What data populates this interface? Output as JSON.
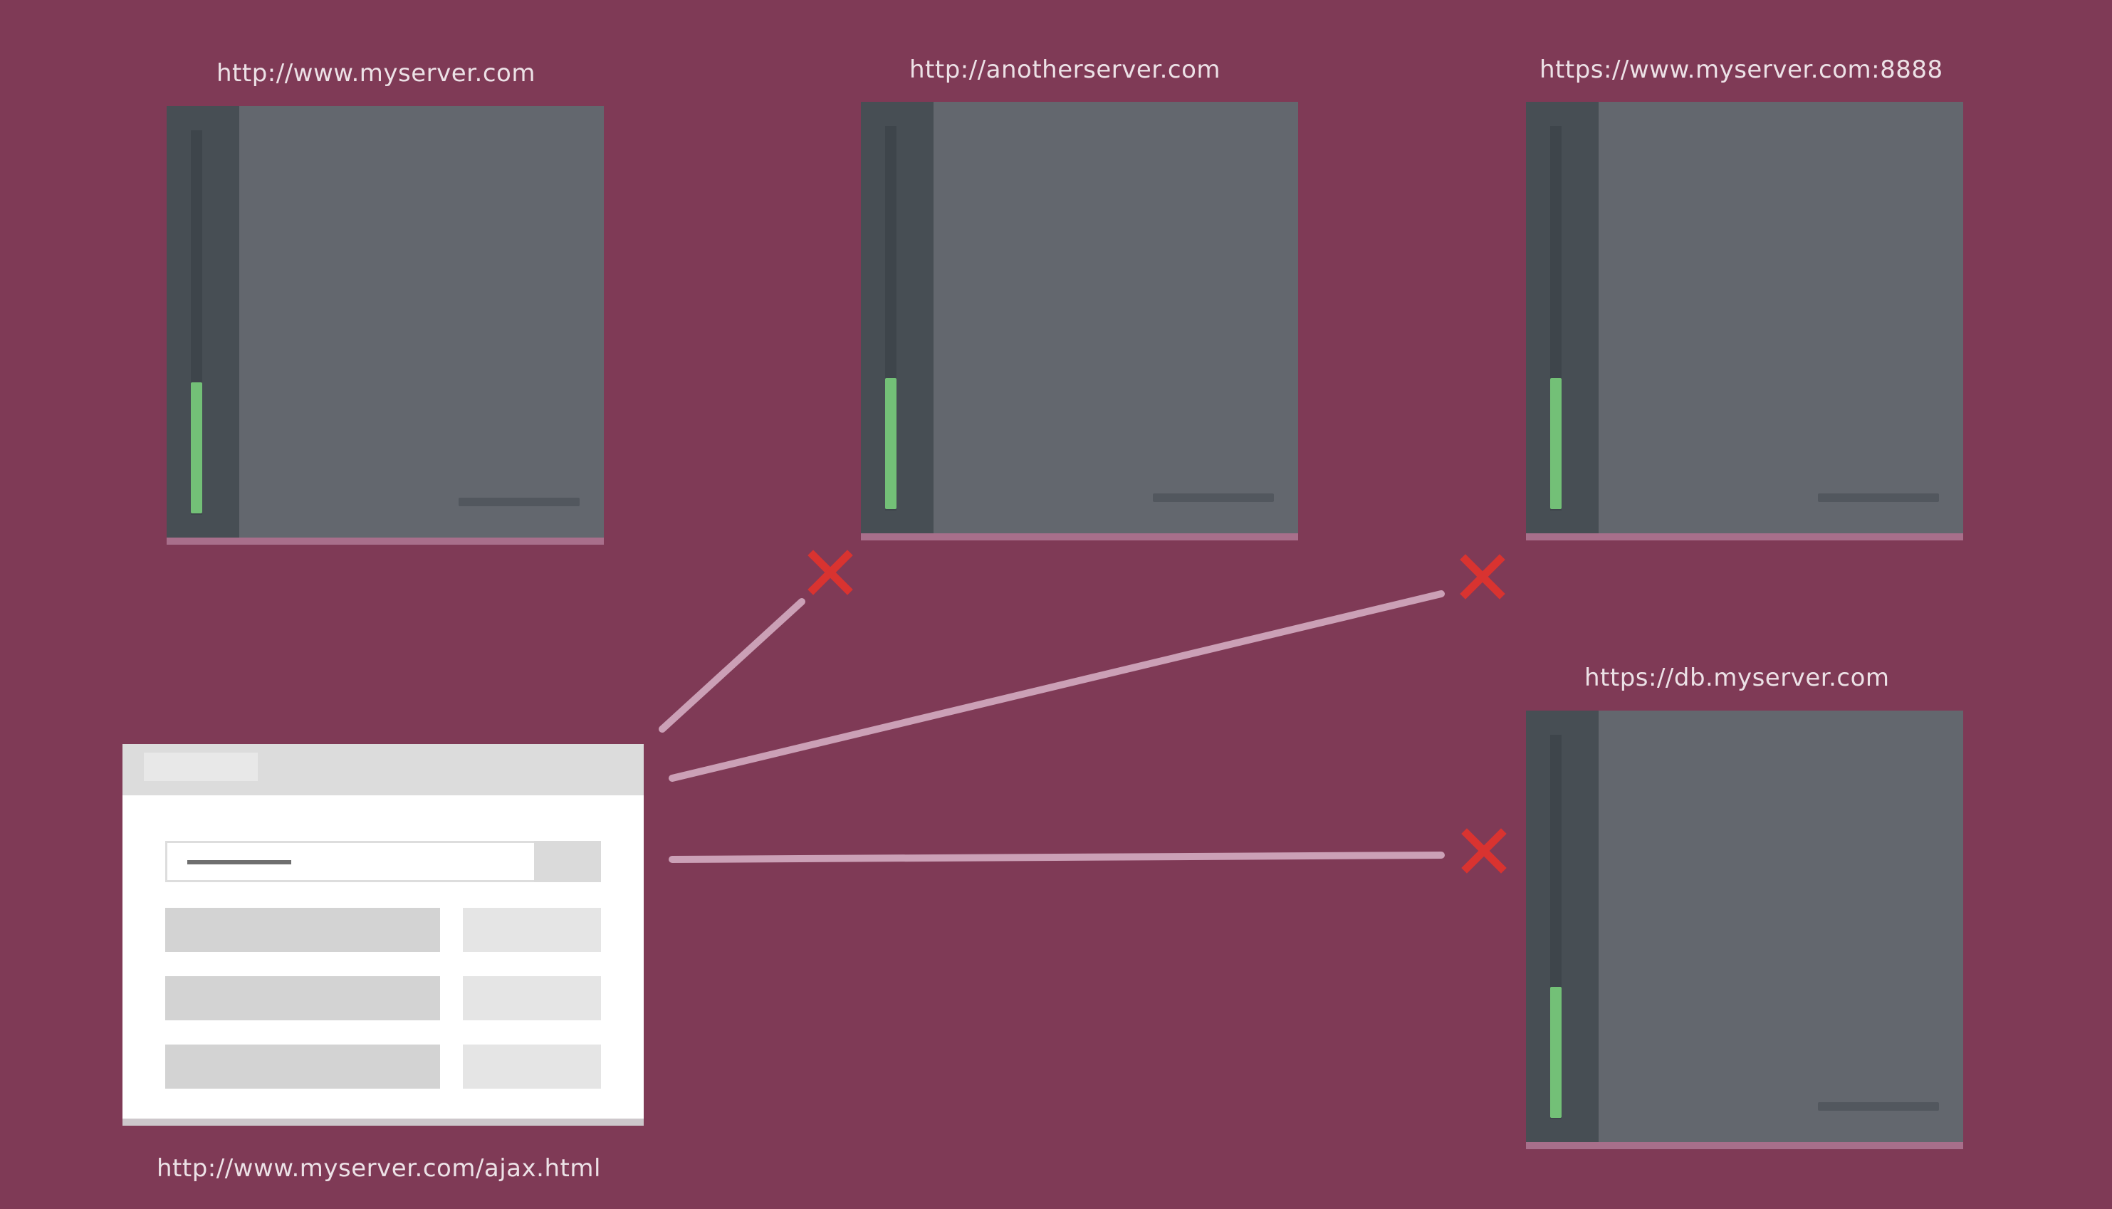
{
  "colors": {
    "background": "#7f3a56",
    "label_text": "#ece1e6",
    "connection_line": "#cba0b6",
    "blocked_marker": "#d93330",
    "server_led": "#73c077"
  },
  "servers": [
    {
      "id": "myserver",
      "url": "http://www.myserver.com",
      "icon": "server-tower-icon"
    },
    {
      "id": "anotherserver",
      "url": "http://anotherserver.com",
      "icon": "server-tower-icon"
    },
    {
      "id": "myserver-8888",
      "url": "https://www.myserver.com:8888",
      "icon": "server-tower-icon"
    },
    {
      "id": "db-myserver",
      "url": "https://db.myserver.com",
      "icon": "server-tower-icon"
    }
  ],
  "browser": {
    "url": "http://www.myserver.com/ajax.html",
    "icon": "browser-window-icon"
  },
  "connections": [
    {
      "from": "browser",
      "to": "anotherserver",
      "status": "blocked",
      "marker_icon": "x-mark-icon"
    },
    {
      "from": "browser",
      "to": "myserver-8888",
      "status": "blocked",
      "marker_icon": "x-mark-icon"
    },
    {
      "from": "browser",
      "to": "db-myserver",
      "status": "blocked",
      "marker_icon": "x-mark-icon"
    }
  ]
}
